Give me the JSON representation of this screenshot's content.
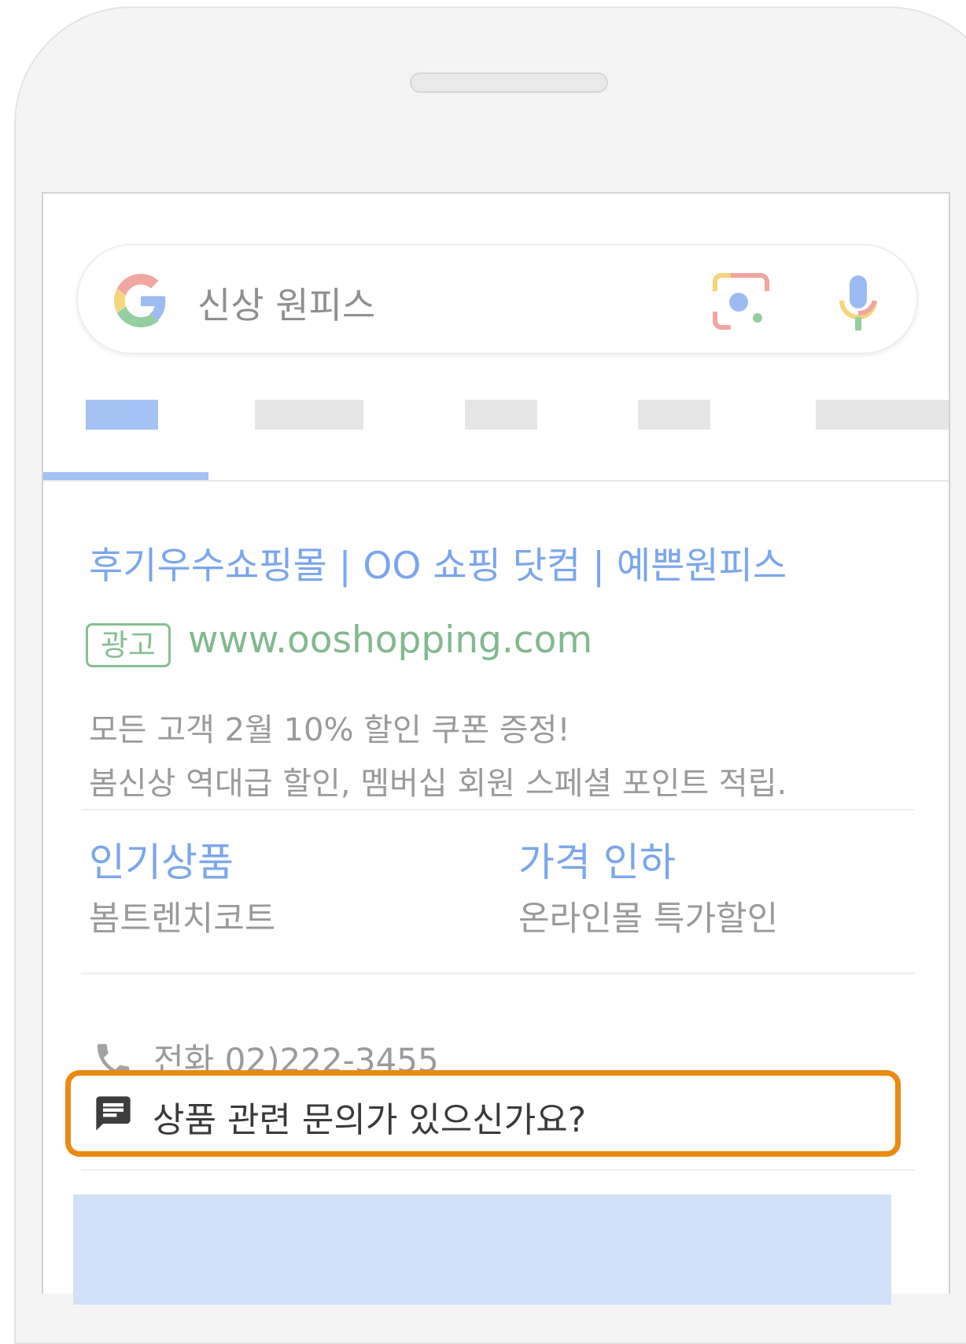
{
  "search": {
    "query": "신상 원피스"
  },
  "ad": {
    "title": "후기우수쇼핑몰 | OO 쇼핑 닷컴 | 예쁜원피스",
    "badge": "광고",
    "url": "www.ooshopping.com",
    "description_line1": "모든 고객 2월 10% 할인 쿠폰 증정!",
    "description_line2": "봄신상 역대급 할인, 멤버십 회원 스페셜 포인트 적립."
  },
  "sitelinks": [
    {
      "title": "인기상품",
      "subtitle": "봄트렌치코트"
    },
    {
      "title": "가격 인하",
      "subtitle": "온라인몰 특가할인"
    }
  ],
  "call": {
    "text": "전화 02)222-3455",
    "icon": "phone-icon"
  },
  "message": {
    "text": "상품 관련 문의가 있으신가요?",
    "icon": "message-icon"
  },
  "colors": {
    "link_blue": "#7aa6ec",
    "url_green": "#81b98f",
    "highlight_orange": "#ea8a10",
    "tab_active": "#a4c2f4"
  }
}
